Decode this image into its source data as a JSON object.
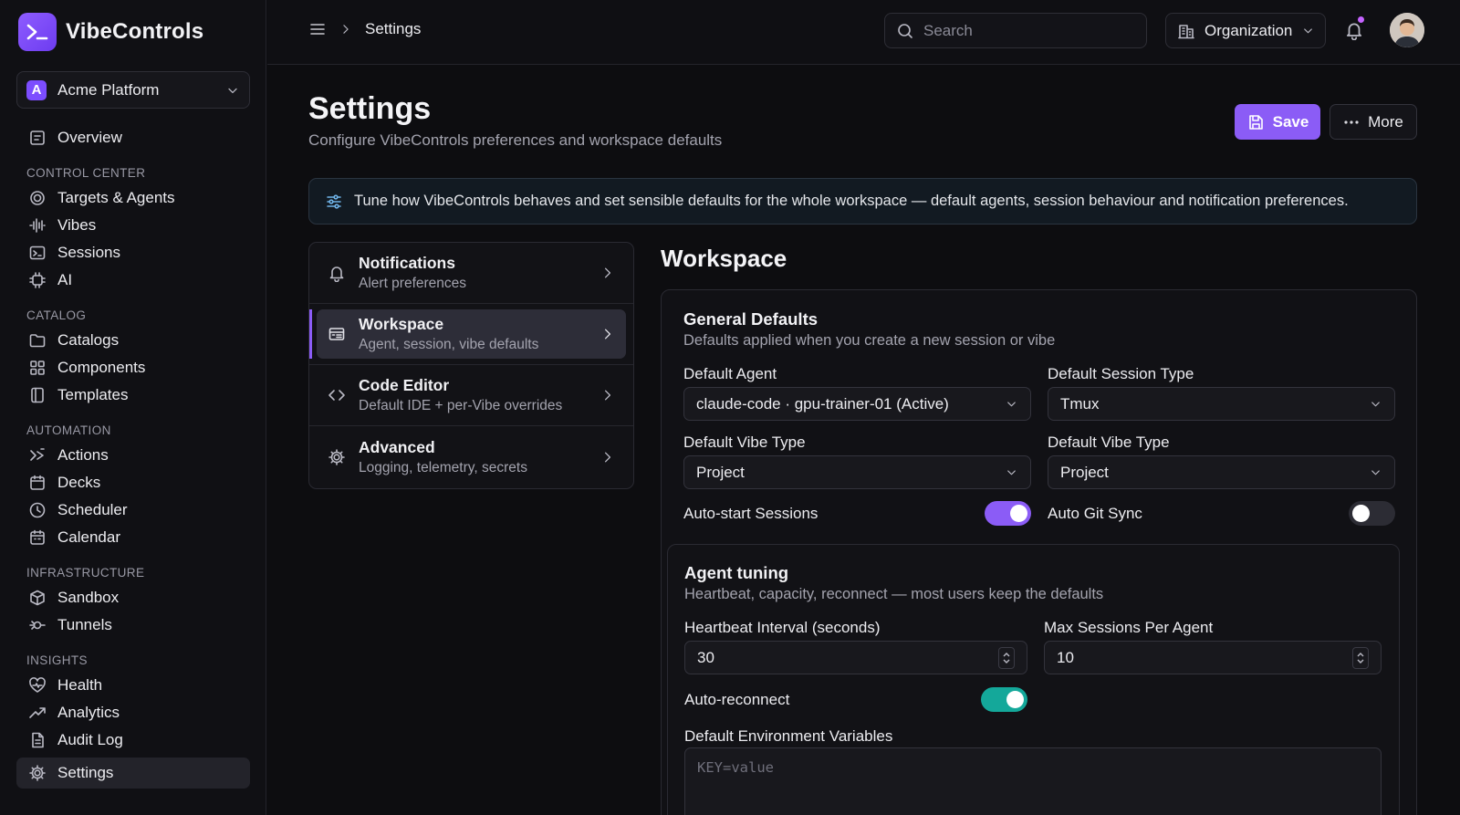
{
  "app": {
    "name": "VibeControls"
  },
  "org_switcher": {
    "badge": "A",
    "name": "Acme Platform"
  },
  "sidebar": {
    "overview": "Overview",
    "sections": [
      {
        "title": "CONTROL CENTER",
        "items": [
          "Targets & Agents",
          "Vibes",
          "Sessions",
          "AI"
        ]
      },
      {
        "title": "CATALOG",
        "items": [
          "Catalogs",
          "Components",
          "Templates"
        ]
      },
      {
        "title": "AUTOMATION",
        "items": [
          "Actions",
          "Decks",
          "Scheduler",
          "Calendar"
        ]
      },
      {
        "title": "INFRASTRUCTURE",
        "items": [
          "Sandbox",
          "Tunnels"
        ]
      },
      {
        "title": "INSIGHTS",
        "items": [
          "Health",
          "Analytics",
          "Audit Log"
        ]
      }
    ],
    "settings": "Settings"
  },
  "topbar": {
    "breadcrumb": "Settings",
    "search_placeholder": "Search",
    "org_button": "Organization"
  },
  "page": {
    "title": "Settings",
    "subtitle": "Configure VibeControls preferences and workspace defaults",
    "save_label": "Save",
    "more_label": "More",
    "info": "Tune how VibeControls behaves and set sensible defaults for the whole workspace — default agents, session behaviour and notification preferences."
  },
  "settings_nav": [
    {
      "title": "Notifications",
      "desc": "Alert preferences"
    },
    {
      "title": "Workspace",
      "desc": "Agent, session, vibe defaults"
    },
    {
      "title": "Code Editor",
      "desc": "Default IDE + per-Vibe overrides"
    },
    {
      "title": "Advanced",
      "desc": "Logging, telemetry, secrets"
    }
  ],
  "workspace": {
    "title": "Workspace",
    "general": {
      "title": "General Defaults",
      "desc": "Defaults applied when you create a new session or vibe",
      "default_agent_label": "Default Agent",
      "default_agent_value": "claude-code · gpu-trainer-01 (Active)",
      "session_type_label": "Default Session Type",
      "session_type_value": "Tmux",
      "vibe_type_label_1": "Default Vibe Type",
      "vibe_type_value_1": "Project",
      "vibe_type_label_2": "Default Vibe Type",
      "vibe_type_value_2": "Project",
      "auto_start_label": "Auto-start Sessions",
      "auto_git_label": "Auto Git Sync"
    },
    "agent_tuning": {
      "title": "Agent tuning",
      "desc": "Heartbeat, capacity, reconnect — most users keep the defaults",
      "heartbeat_label": "Heartbeat Interval (seconds)",
      "heartbeat_value": "30",
      "max_sessions_label": "Max Sessions Per Agent",
      "max_sessions_value": "10",
      "auto_reconnect_label": "Auto-reconnect",
      "env_label": "Default Environment Variables",
      "env_placeholder": "KEY=value"
    }
  },
  "colors": {
    "accent": "#8b5cf6",
    "teal": "#14a89a",
    "background": "#0d0d10"
  }
}
